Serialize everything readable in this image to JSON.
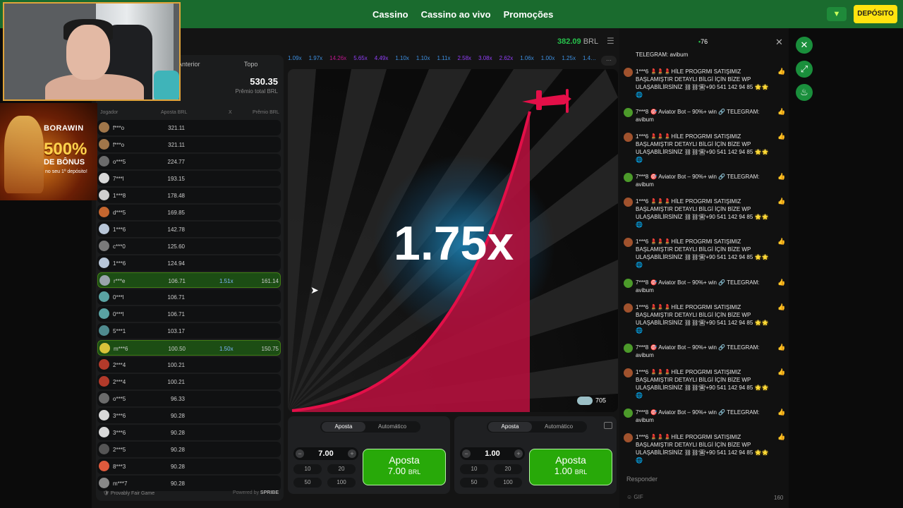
{
  "nav": {
    "items": [
      "Cassino",
      "Cassino ao vivo",
      "Promoções"
    ],
    "deposit_label": "DEPÓSITO"
  },
  "promo": {
    "brand": "BORAWIN",
    "amount": "500%",
    "text": "DE BÔNUS",
    "note": "no seu 1º depósito!"
  },
  "game": {
    "balance": "382.09",
    "currency": "BRL",
    "tabs": [
      "Anterior",
      "Topo"
    ],
    "total_prize": "530.35",
    "total_prize_label": "Prêmio total BRL",
    "columns": [
      "Jogador",
      "Aposta BRL",
      "X",
      "Prêmio BRL"
    ],
    "rows": [
      {
        "name": "f***o",
        "bet": "321.11",
        "mult": "",
        "prize": "",
        "win": false,
        "avatar": "#a0764a"
      },
      {
        "name": "f***o",
        "bet": "321.11",
        "mult": "",
        "prize": "",
        "win": false,
        "avatar": "#a0764a"
      },
      {
        "name": "o***5",
        "bet": "224.77",
        "mult": "",
        "prize": "",
        "win": false,
        "avatar": "#6b6b6b"
      },
      {
        "name": "7***l",
        "bet": "193.15",
        "mult": "",
        "prize": "",
        "win": false,
        "avatar": "#d8d8d8"
      },
      {
        "name": "1***8",
        "bet": "178.48",
        "mult": "",
        "prize": "",
        "win": false,
        "avatar": "#cfcfcf"
      },
      {
        "name": "d***5",
        "bet": "169.85",
        "mult": "",
        "prize": "",
        "win": false,
        "avatar": "#c4662f"
      },
      {
        "name": "1***6",
        "bet": "142.78",
        "mult": "",
        "prize": "",
        "win": false,
        "avatar": "#b8c6d8"
      },
      {
        "name": "c***0",
        "bet": "125.60",
        "mult": "",
        "prize": "",
        "win": false,
        "avatar": "#7a7a7a"
      },
      {
        "name": "1***6",
        "bet": "124.94",
        "mult": "",
        "prize": "",
        "win": false,
        "avatar": "#b8c6d8"
      },
      {
        "name": "r***e",
        "bet": "106.71",
        "mult": "1.51x",
        "prize": "161.14",
        "win": true,
        "avatar": "#9aa4ad"
      },
      {
        "name": "0***l",
        "bet": "106.71",
        "mult": "",
        "prize": "",
        "win": false,
        "avatar": "#5aa3a3"
      },
      {
        "name": "0***l",
        "bet": "106.71",
        "mult": "",
        "prize": "",
        "win": false,
        "avatar": "#5aa3a3"
      },
      {
        "name": "5***1",
        "bet": "103.17",
        "mult": "",
        "prize": "",
        "win": false,
        "avatar": "#4f8b8f"
      },
      {
        "name": "m***6",
        "bet": "100.50",
        "mult": "1.50x",
        "prize": "150.75",
        "win": true,
        "avatar": "#d8c23a"
      },
      {
        "name": "2***4",
        "bet": "100.21",
        "mult": "",
        "prize": "",
        "win": false,
        "avatar": "#b23a2a"
      },
      {
        "name": "2***4",
        "bet": "100.21",
        "mult": "",
        "prize": "",
        "win": false,
        "avatar": "#b23a2a"
      },
      {
        "name": "o***5",
        "bet": "96.33",
        "mult": "",
        "prize": "",
        "win": false,
        "avatar": "#6b6b6b"
      },
      {
        "name": "3***6",
        "bet": "90.28",
        "mult": "",
        "prize": "",
        "win": false,
        "avatar": "#d8d8d8"
      },
      {
        "name": "3***6",
        "bet": "90.28",
        "mult": "",
        "prize": "",
        "win": false,
        "avatar": "#d8d8d8"
      },
      {
        "name": "2***5",
        "bet": "90.28",
        "mult": "",
        "prize": "",
        "win": false,
        "avatar": "#555555"
      },
      {
        "name": "8***3",
        "bet": "90.28",
        "mult": "",
        "prize": "",
        "win": false,
        "avatar": "#e05a3c"
      },
      {
        "name": "m***7",
        "bet": "90.28",
        "mult": "",
        "prize": "",
        "win": false,
        "avatar": "#888888"
      }
    ],
    "fair_label": "Provably Fair Game",
    "powered_label": "Powered by",
    "powered_brand": "SPRIBE",
    "history": [
      {
        "v": "1.09x",
        "c": "#3d8fe0"
      },
      {
        "v": "1.97x",
        "c": "#3d8fe0"
      },
      {
        "v": "14.26x",
        "c": "#c0178e"
      },
      {
        "v": "5.65x",
        "c": "#913ef8"
      },
      {
        "v": "4.49x",
        "c": "#913ef8"
      },
      {
        "v": "1.10x",
        "c": "#3d8fe0"
      },
      {
        "v": "1.10x",
        "c": "#3d8fe0"
      },
      {
        "v": "1.11x",
        "c": "#3d8fe0"
      },
      {
        "v": "2.58x",
        "c": "#913ef8"
      },
      {
        "v": "3.08x",
        "c": "#913ef8"
      },
      {
        "v": "2.62x",
        "c": "#913ef8"
      },
      {
        "v": "1.06x",
        "c": "#3d8fe0"
      },
      {
        "v": "1.00x",
        "c": "#3d8fe0"
      },
      {
        "v": "1.25x",
        "c": "#3d8fe0"
      },
      {
        "v": "1.4…",
        "c": "#3d8fe0"
      }
    ],
    "multiplier": "1.75x",
    "players_count": "705"
  },
  "bets": [
    {
      "tab_active": "Aposta",
      "tab_other": "Automático",
      "amount": "7.00",
      "chips": [
        "10",
        "20",
        "50",
        "100"
      ],
      "button_label": "Aposta",
      "button_amount": "7.00",
      "button_currency": "BRL"
    },
    {
      "tab_active": "Aposta",
      "tab_other": "Automático",
      "amount": "1.00",
      "chips": [
        "10",
        "20",
        "50",
        "100"
      ],
      "button_label": "Aposta",
      "button_amount": "1.00",
      "button_currency": "BRL"
    }
  ],
  "chat": {
    "online": "76",
    "messages": [
      {
        "text": "TELEGRAM: avibum",
        "green": true,
        "partial": true
      },
      {
        "text": "1***6 💄💄💄HİLE PROGRMI SATIŞIMIZ BAŞLAMIŞTIR DETAYLI BİLGİ İÇİN BİZE WP ULAŞABİLİRSİNİZ ⛓⛓☎+90 541 142 94 85 🌟🌟🌐",
        "green": false
      },
      {
        "text": "7***8 🎯 Aviator Bot – 90%+ win 🔗 TELEGRAM: avibum",
        "green": true
      },
      {
        "text": "1***6 💄💄💄HİLE PROGRMI SATIŞIMIZ BAŞLAMIŞTIR DETAYLI BİLGİ İÇİN BİZE WP ULAŞABİLİRSİNİZ ⛓⛓☎+90 541 142 94 85 🌟🌟🌐",
        "green": false
      },
      {
        "text": "7***8 🎯 Aviator Bot – 90%+ win 🔗 TELEGRAM: avibum",
        "green": true
      },
      {
        "text": "1***6 💄💄💄HİLE PROGRMI SATIŞIMIZ BAŞLAMIŞTIR DETAYLI BİLGİ İÇİN BİZE WP ULAŞABİLİRSİNİZ ⛓⛓☎+90 541 142 94 85 🌟🌟🌐",
        "green": false
      },
      {
        "text": "1***6 💄💄💄HİLE PROGRMI SATIŞIMIZ BAŞLAMIŞTIR DETAYLI BİLGİ İÇİN BİZE WP ULAŞABİLİRSİNİZ ⛓⛓☎+90 541 142 94 85 🌟🌟🌐",
        "green": false
      },
      {
        "text": "7***8 🎯 Aviator Bot – 90%+ win 🔗 TELEGRAM: avibum",
        "green": true
      },
      {
        "text": "1***6 💄💄💄HİLE PROGRMI SATIŞIMIZ BAŞLAMIŞTIR DETAYLI BİLGİ İÇİN BİZE WP ULAŞABİLİRSİNİZ ⛓⛓☎+90 541 142 94 85 🌟🌟🌐",
        "green": false
      },
      {
        "text": "7***8 🎯 Aviator Bot – 90%+ win 🔗 TELEGRAM: avibum",
        "green": true
      },
      {
        "text": "1***6 💄💄💄HİLE PROGRMI SATIŞIMIZ BAŞLAMIŞTIR DETAYLI BİLGİ İÇİN BİZE WP ULAŞABİLİRSİNİZ ⛓⛓☎+90 541 142 94 85 🌟🌟🌐",
        "green": false
      },
      {
        "text": "7***8 🎯 Aviator Bot – 90%+ win 🔗 TELEGRAM: avibum",
        "green": true
      },
      {
        "text": "1***6 💄💄💄HİLE PROGRMI SATIŞIMIZ BAŞLAMIŞTIR DETAYLI BİLGİ İÇİN BİZE WP ULAŞABİLİRSİNİZ ⛓⛓☎+90 541 142 94 85 🌟🌟🌐",
        "green": false
      }
    ],
    "reply_placeholder": "Responder",
    "gif_label": "GIF",
    "char_count": "160"
  },
  "icons": [
    "chevron-down-icon",
    "close-icon",
    "expand-icon",
    "fire-icon",
    "menu-icon",
    "plane-icon",
    "cursor-icon"
  ]
}
